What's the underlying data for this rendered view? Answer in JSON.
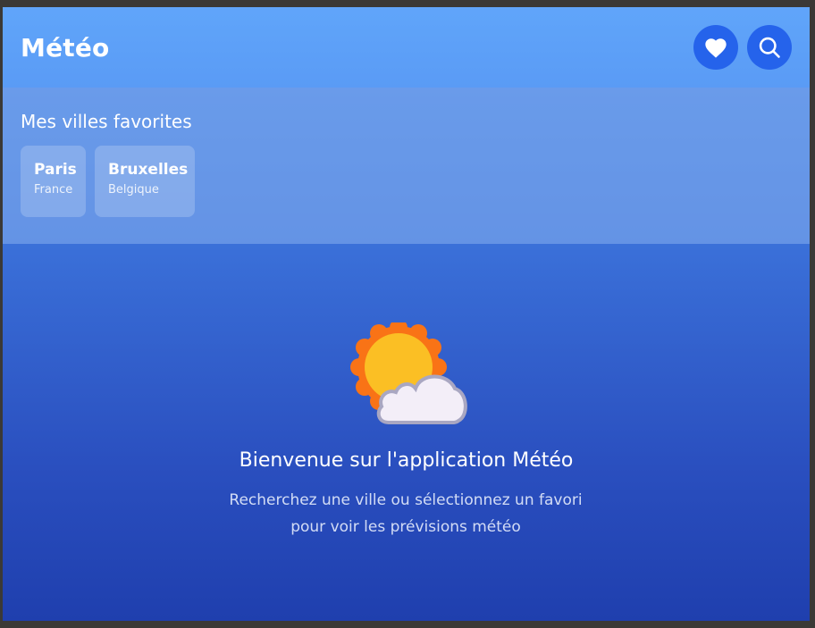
{
  "header": {
    "title": "Météo",
    "favorites_button_icon": "heart-icon",
    "search_button_icon": "search-icon"
  },
  "favorites": {
    "heading": "Mes villes favorites",
    "items": [
      {
        "city": "Paris",
        "country": "France"
      },
      {
        "city": "Bruxelles",
        "country": "Belgique"
      }
    ]
  },
  "welcome": {
    "icon": "partly-cloudy-icon",
    "title": "Bienvenue sur l'application Météo",
    "text": "Recherchez une ville ou sélectionnez un favori pour voir les prévisions météo"
  },
  "colors": {
    "header_bg": "#60a5fa",
    "button_bg": "#2563eb",
    "sun": "#fbbf24",
    "sun_rays": "#f97316",
    "cloud": "#f3eef8"
  }
}
